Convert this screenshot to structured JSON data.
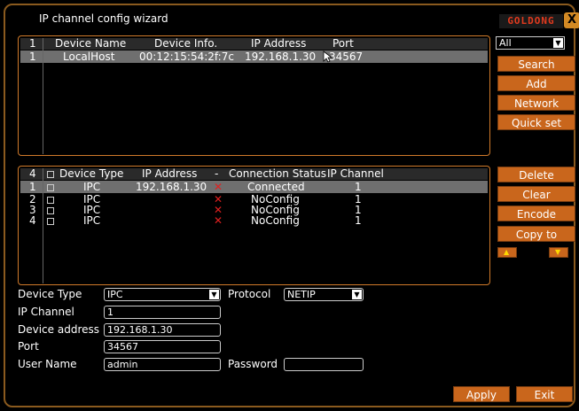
{
  "window": {
    "title": "IP channel config wizard",
    "logo": "GOLDONG",
    "close": "X"
  },
  "search_panel": {
    "count": "1",
    "headers": [
      "Device Name",
      "Device Info.",
      "IP Address",
      "Port"
    ],
    "rows": [
      {
        "index": "1",
        "device_name": "LocalHost",
        "device_info": "00:12:15:54:2f:7c",
        "ip": "192.168.1.30",
        "port": "34567"
      }
    ]
  },
  "side_top": {
    "filter": "All",
    "search": "Search",
    "add": "Add",
    "network": "Network",
    "quick_set": "Quick set"
  },
  "channel_panel": {
    "count": "4",
    "headers": {
      "device_type": "Device Type",
      "ip": "IP Address",
      "dash": "-",
      "status": "Connection Status",
      "channel": "IP Channel"
    },
    "rows": [
      {
        "index": "1",
        "type": "IPC",
        "ip": "192.168.1.30",
        "status": "Connected",
        "channel": "1"
      },
      {
        "index": "2",
        "type": "IPC",
        "ip": "",
        "status": "NoConfig",
        "channel": "1"
      },
      {
        "index": "3",
        "type": "IPC",
        "ip": "",
        "status": "NoConfig",
        "channel": "1"
      },
      {
        "index": "4",
        "type": "IPC",
        "ip": "",
        "status": "NoConfig",
        "channel": "1"
      }
    ]
  },
  "side_bottom": {
    "delete": "Delete",
    "clear": "Clear",
    "encode": "Encode",
    "copy_to": "Copy to"
  },
  "form": {
    "device_type_label": "Device Type",
    "device_type": "IPC",
    "protocol_label": "Protocol",
    "protocol": "NETIP",
    "ip_channel_label": "IP Channel",
    "ip_channel": "1",
    "device_address_label": "Device address",
    "device_address": "192.168.1.30",
    "port_label": "Port",
    "port": "34567",
    "user_name_label": "User Name",
    "user_name": "admin",
    "password_label": "Password",
    "password": ""
  },
  "footer": {
    "apply": "Apply",
    "exit": "Exit"
  }
}
